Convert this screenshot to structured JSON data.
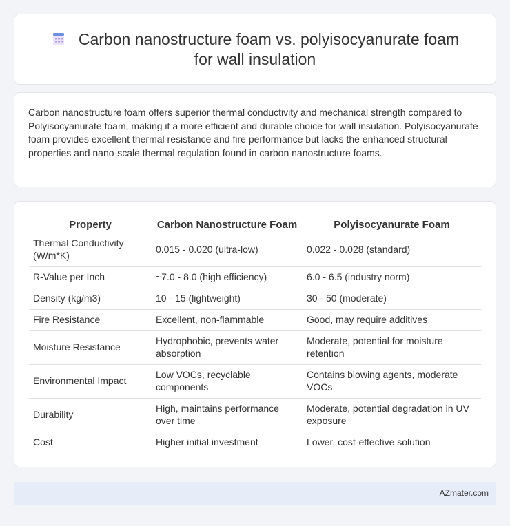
{
  "header": {
    "icon": "document-icon",
    "title": "Carbon nanostructure foam vs. polyisocyanurate foam for wall insulation"
  },
  "summary": {
    "text": "Carbon nanostructure foam offers superior thermal conductivity and mechanical strength compared to Polyisocyanurate foam, making it a more efficient and durable choice for wall insulation. Polyisocyanurate foam provides excellent thermal resistance and fire performance but lacks the enhanced structural properties and nano-scale thermal regulation found in carbon nanostructure foams."
  },
  "table": {
    "headers": [
      "Property",
      "Carbon Nanostructure Foam",
      "Polyisocyanurate Foam"
    ],
    "rows": [
      [
        "Thermal Conductivity (W/m*K)",
        "0.015 - 0.020 (ultra-low)",
        "0.022 - 0.028 (standard)"
      ],
      [
        "R-Value per Inch",
        "~7.0 - 8.0 (high efficiency)",
        "6.0 - 6.5 (industry norm)"
      ],
      [
        "Density (kg/m3)",
        "10 - 15 (lightweight)",
        "30 - 50 (moderate)"
      ],
      [
        "Fire Resistance",
        "Excellent, non-flammable",
        "Good, may require additives"
      ],
      [
        "Moisture Resistance",
        "Hydrophobic, prevents water absorption",
        "Moderate, potential for moisture retention"
      ],
      [
        "Environmental Impact",
        "Low VOCs, recyclable components",
        "Contains blowing agents, moderate VOCs"
      ],
      [
        "Durability",
        "High, maintains performance over time",
        "Moderate, potential degradation in UV exposure"
      ],
      [
        "Cost",
        "Higher initial investment",
        "Lower, cost-effective solution"
      ]
    ]
  },
  "footer": {
    "brand": "AZmater.com"
  }
}
